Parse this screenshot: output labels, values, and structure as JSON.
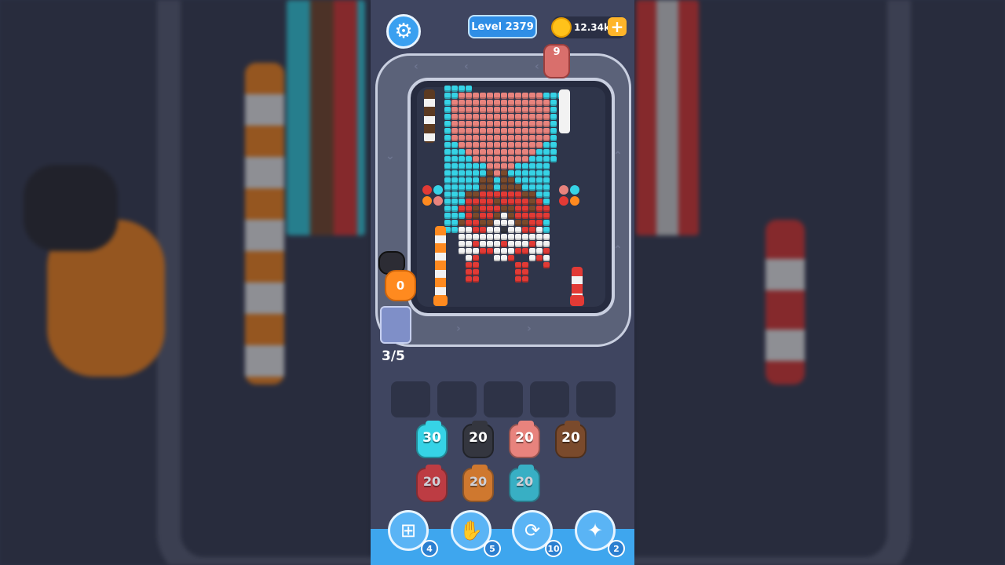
{
  "header": {
    "settings_icon": "gear-icon",
    "level_label": "Level 2379",
    "coins": "12.34k",
    "add_coins_symbol": "+"
  },
  "board": {
    "incoming_count": "9",
    "shooter_count": "0",
    "capacity": "3/5"
  },
  "slots": {
    "count": 5,
    "filled": 0
  },
  "queue": {
    "row1": [
      {
        "value": "30",
        "color": "#36d3e6"
      },
      {
        "value": "20",
        "color": "#34363f"
      },
      {
        "value": "20",
        "color": "#e8837d"
      },
      {
        "value": "20",
        "color": "#7a4a2c"
      }
    ],
    "row2": [
      {
        "value": "20",
        "color": "#e8393a"
      },
      {
        "value": "20",
        "color": "#ff8a1f"
      },
      {
        "value": "20",
        "color": "#36d3e6"
      }
    ]
  },
  "powerups": [
    {
      "name": "add-slot",
      "icon": "add-slot-icon",
      "count": "4"
    },
    {
      "name": "hand",
      "icon": "hand-icon",
      "count": "5"
    },
    {
      "name": "shuffle",
      "icon": "shuffle-icon",
      "count": "10"
    },
    {
      "name": "magic",
      "icon": "magic-icon",
      "count": "2"
    }
  ],
  "colors": {
    "cyan": "#36d3e6",
    "salmon": "#e8837d",
    "red": "#e23a35",
    "brown": "#7a4a2c",
    "white": "#f2f2f2",
    "orange": "#ff8a1f",
    "black": "#34363f"
  }
}
